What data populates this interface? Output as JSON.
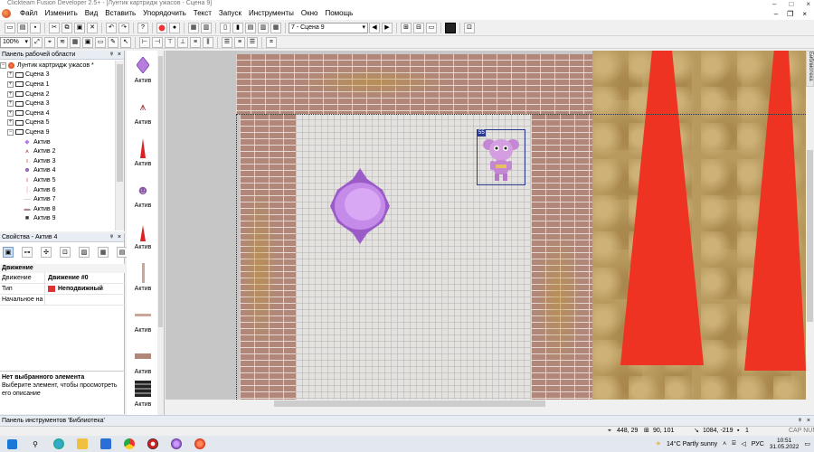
{
  "window": {
    "title": "Clickteam Fusion Developer 2.5+ - [Лунтик картридж ужасов - Сцена 9]"
  },
  "menu": [
    "Файл",
    "Изменить",
    "Вид",
    "Вставить",
    "Упорядочить",
    "Текст",
    "Запуск",
    "Инструменты",
    "Окно",
    "Помощь"
  ],
  "toolbar": {
    "scene_select": "7 - Сцена 9",
    "zoom": "100%"
  },
  "workspace": {
    "title": "Панель рабочей области",
    "project": "Лунтик картридж ужасов *",
    "scenes": [
      "Сцена 3",
      "Сцена 1",
      "Сцена 2",
      "Сцена 3",
      "Сцена 4",
      "Сцена 5",
      "Сцена 9"
    ],
    "objects": [
      "Актив",
      "Актив 2",
      "Актив 3",
      "Актив 4",
      "Актив 5",
      "Актив 6",
      "Актив 7",
      "Актив 8",
      "Актив 9"
    ]
  },
  "properties": {
    "title": "Свойства - Актив 4",
    "section": "Движение",
    "rows": [
      {
        "key": "Движение",
        "value": "Движение #0"
      },
      {
        "key": "Тип",
        "value": "Неподвижный"
      },
      {
        "key": "Начальное на",
        "value": ""
      }
    ],
    "desc_title": "Нет выбранного элемента",
    "desc_text": "Выберите элемент, чтобы просмотреть его описание"
  },
  "library": {
    "label": "Актив",
    "bar_title": "Панель инструментов 'Библиотека'"
  },
  "scene": {
    "selected_tag": "55"
  },
  "side_tab": "Библиотека",
  "status": {
    "coords": "448, 29",
    "size": "90, 101",
    "pos": "1084, -219",
    "count": "1",
    "caps": "CAP NUM"
  },
  "taskbar": {
    "weather": "14°C  Partly sunny",
    "lang": "РУС",
    "time": "10:51",
    "date": "31.05.2022"
  },
  "colors": {
    "cone": "#ee3322",
    "crystal": "#b57edc",
    "selection": "#2b3a8f"
  }
}
